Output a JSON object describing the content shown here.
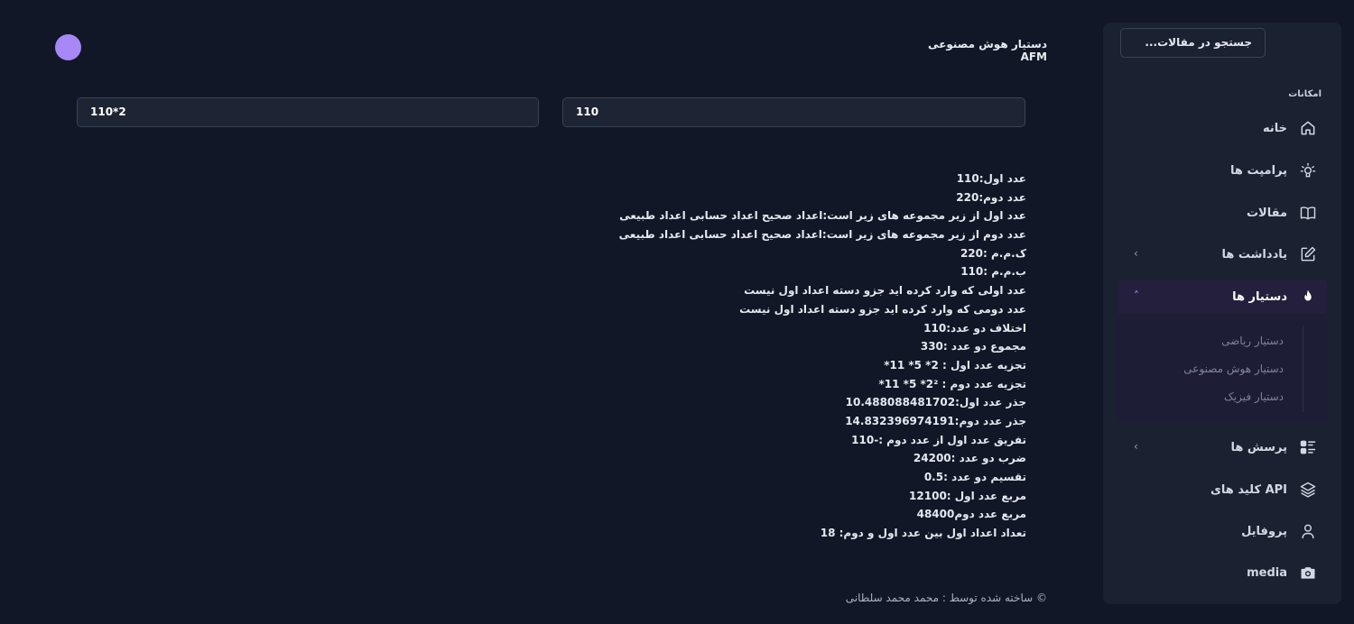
{
  "header": {
    "title": "دستیار هوش مصنوعی AFM"
  },
  "inputs": {
    "first": "110",
    "second": "110*2"
  },
  "sidebar": {
    "search_label": "جستجو در مقالات...",
    "section_title": "امکانات",
    "items": [
      {
        "label": "خانه",
        "icon": "home-icon"
      },
      {
        "label": "پرامپت ها",
        "icon": "bulb-icon"
      },
      {
        "label": "مقالات",
        "icon": "book-icon"
      },
      {
        "label": "یادداشت ها",
        "icon": "edit-icon"
      },
      {
        "label": "دستیار ها",
        "icon": "flame-icon"
      },
      {
        "label": "پرسش ها",
        "icon": "list-icon"
      },
      {
        "label": "کلید های API",
        "icon": "layers-icon"
      },
      {
        "label": "پروفایل",
        "icon": "user-icon"
      },
      {
        "label": "media",
        "icon": "camera-icon"
      }
    ],
    "submenu": [
      "دستیار ریاضی",
      "دستیار هوش مصنوعی",
      "دستیار فیزیک"
    ],
    "accent": "#a78bfa"
  },
  "results": [
    "عدد اول:110",
    "عدد دوم:220",
    "عدد اول از زیر مجموعه های زیر است:اعداد صحیح اعداد حسابی اعداد طبیعی",
    "عدد دوم از زیر مجموعه های زیر است:اعداد صحیح اعداد حسابی اعداد طبیعی",
    "ک.م.م :220",
    "ب.م.م :110",
    "عدد اولی که وارد کرده اید جزو دسته اعداد اول نیست",
    "عدد دومی که وارد کرده اید جزو دسته اعداد اول نیست",
    "اختلاف دو عدد:110",
    "مجموع دو عدد :330",
    "تجزیه عدد اول : 2* 5* 11*",
    "تجزیه عدد دوم : 2²* 5* 11*",
    "جذر عدد اول:10.488088481702",
    "جذر عدد دوم:14.832396974191",
    "تفریق عدد اول از عدد دوم :-110",
    "ضرب دو عدد :24200",
    "تقسیم دو عدد :0.5",
    "مربع عدد اول :12100",
    "مربع عدد دوم48400",
    "تعداد اعداد اول بین عدد اول و دوم: 18"
  ],
  "footer": "© ساخته شده توسط : محمد محمد سلطانی",
  "colors": {
    "background": "#111726",
    "sidebar": "#1a2130",
    "avatar": "#a887f7"
  }
}
